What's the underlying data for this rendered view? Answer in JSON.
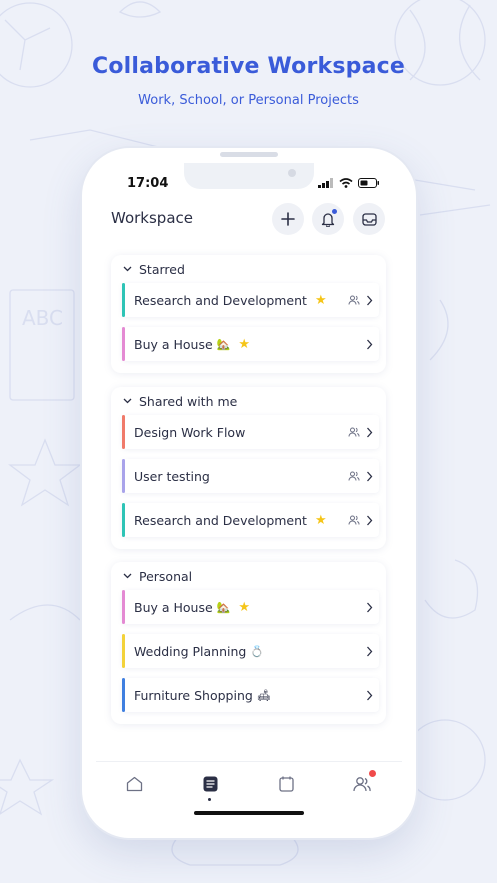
{
  "promo": {
    "title": "Collaborative Workspace",
    "subtitle": "Work, School, or Personal Projects"
  },
  "status_bar": {
    "time": "17:04",
    "icons": [
      "signal-icon",
      "wifi-icon",
      "battery-icon"
    ]
  },
  "header": {
    "title": "Workspace",
    "actions": [
      "plus-icon",
      "bell-icon",
      "inbox-icon"
    ]
  },
  "colors": {
    "accent": "#3a5bd9",
    "teal": "#2ec4b6",
    "pink": "#e48ad3",
    "red": "#f07a6a",
    "lavender": "#a9a3ea",
    "yellow": "#f3d23a",
    "blue": "#3f7fe0",
    "star": "#f5c518",
    "badge": "#f04a4a"
  },
  "sections": [
    {
      "title": "Starred",
      "items": [
        {
          "label": "Research and Development",
          "color": "#2ec4b6",
          "starred": true,
          "emoji": "",
          "shared": true
        },
        {
          "label": "Buy a House",
          "color": "#e48ad3",
          "starred": true,
          "emoji": "🏡",
          "shared": false
        }
      ]
    },
    {
      "title": "Shared with me",
      "items": [
        {
          "label": "Design Work Flow",
          "color": "#f07a6a",
          "starred": false,
          "emoji": "",
          "shared": true
        },
        {
          "label": "User testing",
          "color": "#a9a3ea",
          "starred": false,
          "emoji": "",
          "shared": true
        },
        {
          "label": "Research and Development",
          "color": "#2ec4b6",
          "starred": true,
          "emoji": "",
          "shared": true
        }
      ]
    },
    {
      "title": "Personal",
      "items": [
        {
          "label": "Buy a House",
          "color": "#e48ad3",
          "starred": true,
          "emoji": "🏡",
          "shared": false
        },
        {
          "label": "Wedding Planning",
          "color": "#f3d23a",
          "starred": false,
          "emoji": "💍",
          "shared": false
        },
        {
          "label": "Furniture Shopping",
          "color": "#3f7fe0",
          "starred": false,
          "emoji": "🛋",
          "shared": false
        }
      ]
    }
  ],
  "tabbar": {
    "tabs": [
      "home-icon",
      "list-icon",
      "calendar-icon",
      "people-icon"
    ],
    "active": "list-icon"
  }
}
